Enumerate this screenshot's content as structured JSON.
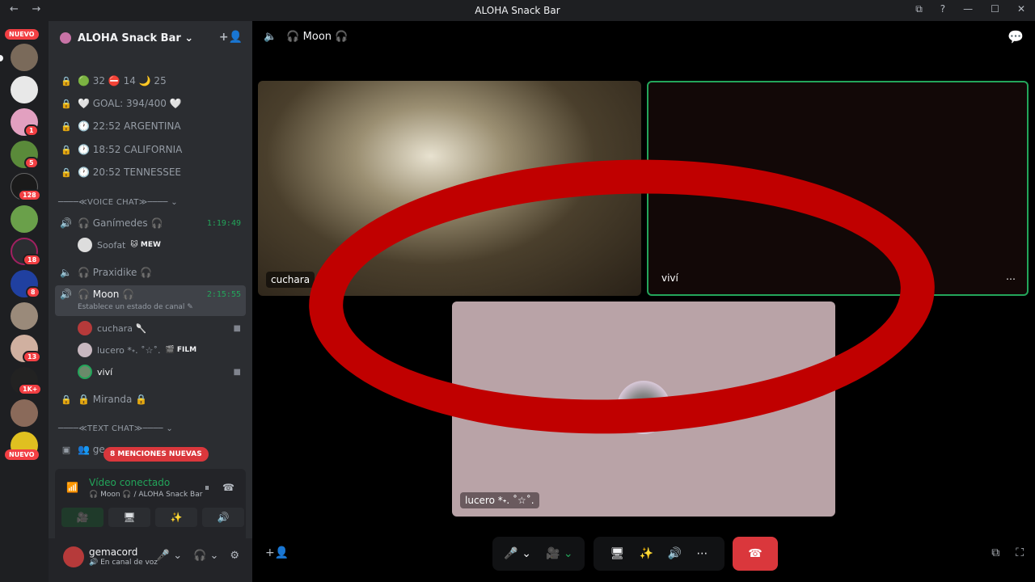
{
  "window": {
    "title": "ALOHA Snack Bar",
    "back": "←",
    "forward": "→",
    "right_icons": [
      "⧉",
      "?",
      "—",
      "☐",
      "✕"
    ]
  },
  "rail": {
    "new_top": "NUEVO",
    "new_bottom": "NUEVO",
    "badges": [
      "1",
      "5",
      "128",
      "18",
      "8",
      "13",
      "1K+"
    ]
  },
  "server": {
    "name": "ALOHA Snack Bar ⌄",
    "invite_icon": "+👤"
  },
  "channels": {
    "info": [
      {
        "lock": "🔒",
        "text": "🟢 32 ⛔ 14 🌙 25"
      },
      {
        "lock": "🔒",
        "text": "🤍 GOAL: 394/400 🤍"
      },
      {
        "lock": "🔒",
        "text": "🕐 22:52 ARGENTINA"
      },
      {
        "lock": "🔒",
        "text": "🕐 18:52 CALIFORNIA"
      },
      {
        "lock": "🔒",
        "text": "🕐 20:52 TENNESSEE"
      }
    ],
    "voice_category": "────≪VOICE CHAT≫──── ⌄",
    "ganimedes": {
      "name": "🎧 Ganímedes 🎧",
      "timer": "1:19:49"
    },
    "soofat": {
      "name": "Soofat",
      "tag": "🐱 MEW"
    },
    "praxidike": {
      "name": "🎧 Praxidike 🎧"
    },
    "moon": {
      "name": "🎧 Moon 🎧",
      "timer": "2:15:55",
      "status": "Establece un estado de canal ✎"
    },
    "moon_users": [
      {
        "name": "cuchara 🥄",
        "tag": ""
      },
      {
        "name": "lucero *˖. ˚☆˚.",
        "tag": "🎬 FILM"
      },
      {
        "name": "viví",
        "tag": ""
      }
    ],
    "miranda": {
      "lock": "🔒",
      "name": "🔒 Miranda 🔒"
    },
    "text_category": "────≪TEXT CHAT≫──── ⌄",
    "text_channel": "👥 ge",
    "mentions": "8 MENCIONES NUEVAS"
  },
  "voice_panel": {
    "title": "Vídeo conectado",
    "subtitle": "🎧 Moon 🎧 / ALOHA Snack Bar",
    "icons": [
      "📶",
      "⏸",
      "☎"
    ],
    "buttons": [
      "🎥",
      "🖥",
      "✨",
      "🔊"
    ]
  },
  "user": {
    "name": "gemacord",
    "status": "🔊 En canal de voz",
    "controls": [
      "🎤 ⌄",
      "🎧 ⌄",
      "⚙"
    ]
  },
  "main": {
    "channel_title": "🎧 Moon 🎧",
    "speaker_icon": "🔈",
    "chat_icon": "💬"
  },
  "tiles": [
    {
      "label": "cuchara"
    },
    {
      "label": "viví",
      "more": "⋯"
    },
    {
      "label": "lucero *˖. ˚☆˚."
    }
  ],
  "controls": {
    "mic": "🎤 ⌄",
    "camera": "🎥 ⌄",
    "screen": "🖥",
    "activities": "✨",
    "soundboard": "🔊",
    "more": "⋯",
    "leave": "☎",
    "add_user": "+👤",
    "popout": "⧉",
    "fullscreen": "⛶"
  }
}
